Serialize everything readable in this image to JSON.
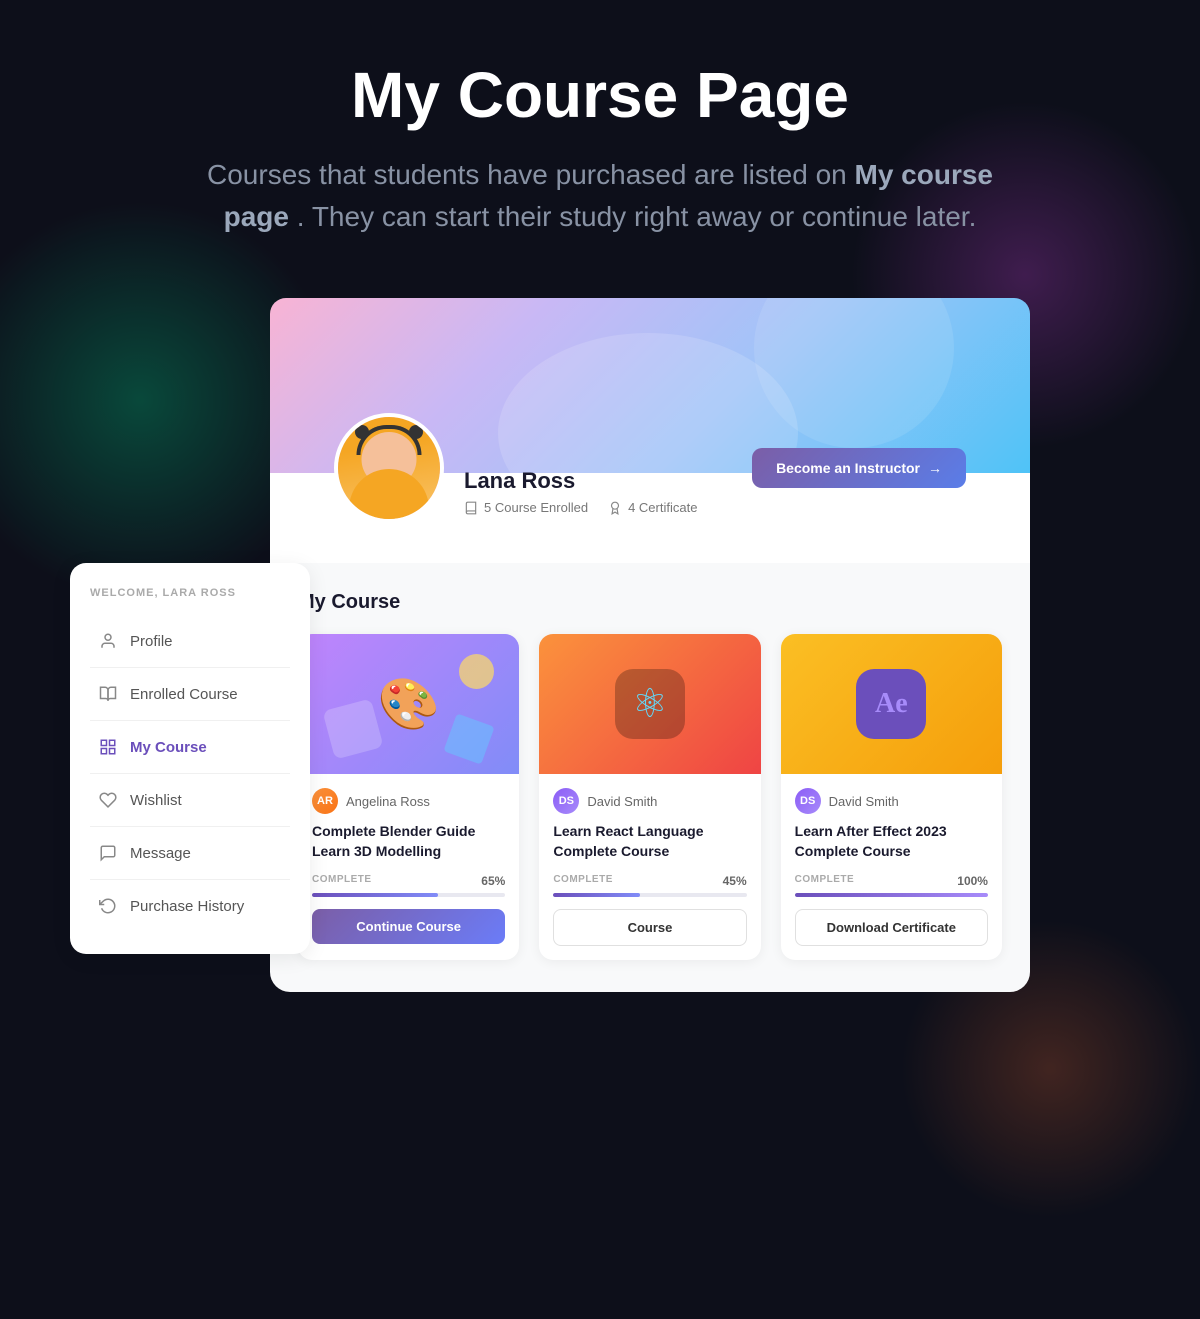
{
  "hero": {
    "title": "My Course Page",
    "subtitle_plain": "Courses that students have purchased are listed on ",
    "subtitle_bold": "My course page",
    "subtitle_end": ". They can start their study right away or continue later."
  },
  "profile": {
    "name": "Lana Ross",
    "courses_enrolled": "5 Course Enrolled",
    "certificates": "4 Certificate",
    "instructor_btn": "Become an Instructor"
  },
  "sidebar": {
    "welcome": "Welcome, Lara Ross",
    "items": [
      {
        "id": "profile",
        "label": "Profile",
        "active": false
      },
      {
        "id": "enrolled-course",
        "label": "Enrolled Course",
        "active": false
      },
      {
        "id": "my-course",
        "label": "My Course",
        "active": true
      },
      {
        "id": "wishlist",
        "label": "Wishlist",
        "active": false
      },
      {
        "id": "message",
        "label": "Message",
        "active": false
      },
      {
        "id": "purchase-history",
        "label": "Purchase History",
        "active": false
      }
    ]
  },
  "my_course": {
    "section_title": "My Course",
    "courses": [
      {
        "id": "blender",
        "author": "Angelina Ross",
        "author_initials": "AR",
        "title": "Complete Blender Guide Learn 3D Modelling",
        "progress_label": "COMPLETE",
        "progress_pct": 65,
        "progress_pct_label": "65%",
        "action_label": "Continue Course",
        "action_type": "continue",
        "thumb_type": "purple",
        "thumb_emoji": "🎨"
      },
      {
        "id": "react",
        "author": "David Smith",
        "author_initials": "DS",
        "title": "Learn React Language Complete Course",
        "progress_label": "COMPLETE",
        "progress_pct": 45,
        "progress_pct_label": "45%",
        "action_label": "Course",
        "action_type": "course",
        "thumb_type": "orange",
        "thumb_emoji": "⚛"
      },
      {
        "id": "aftereffects",
        "author": "David Smith",
        "author_initials": "DS",
        "title": "Learn After Effect 2023 Complete Course",
        "progress_label": "COMPLETE",
        "progress_pct": 100,
        "progress_pct_label": "100%",
        "action_label": "Download Certificate",
        "action_type": "download",
        "thumb_type": "yellow",
        "thumb_emoji": "Ae"
      }
    ]
  }
}
